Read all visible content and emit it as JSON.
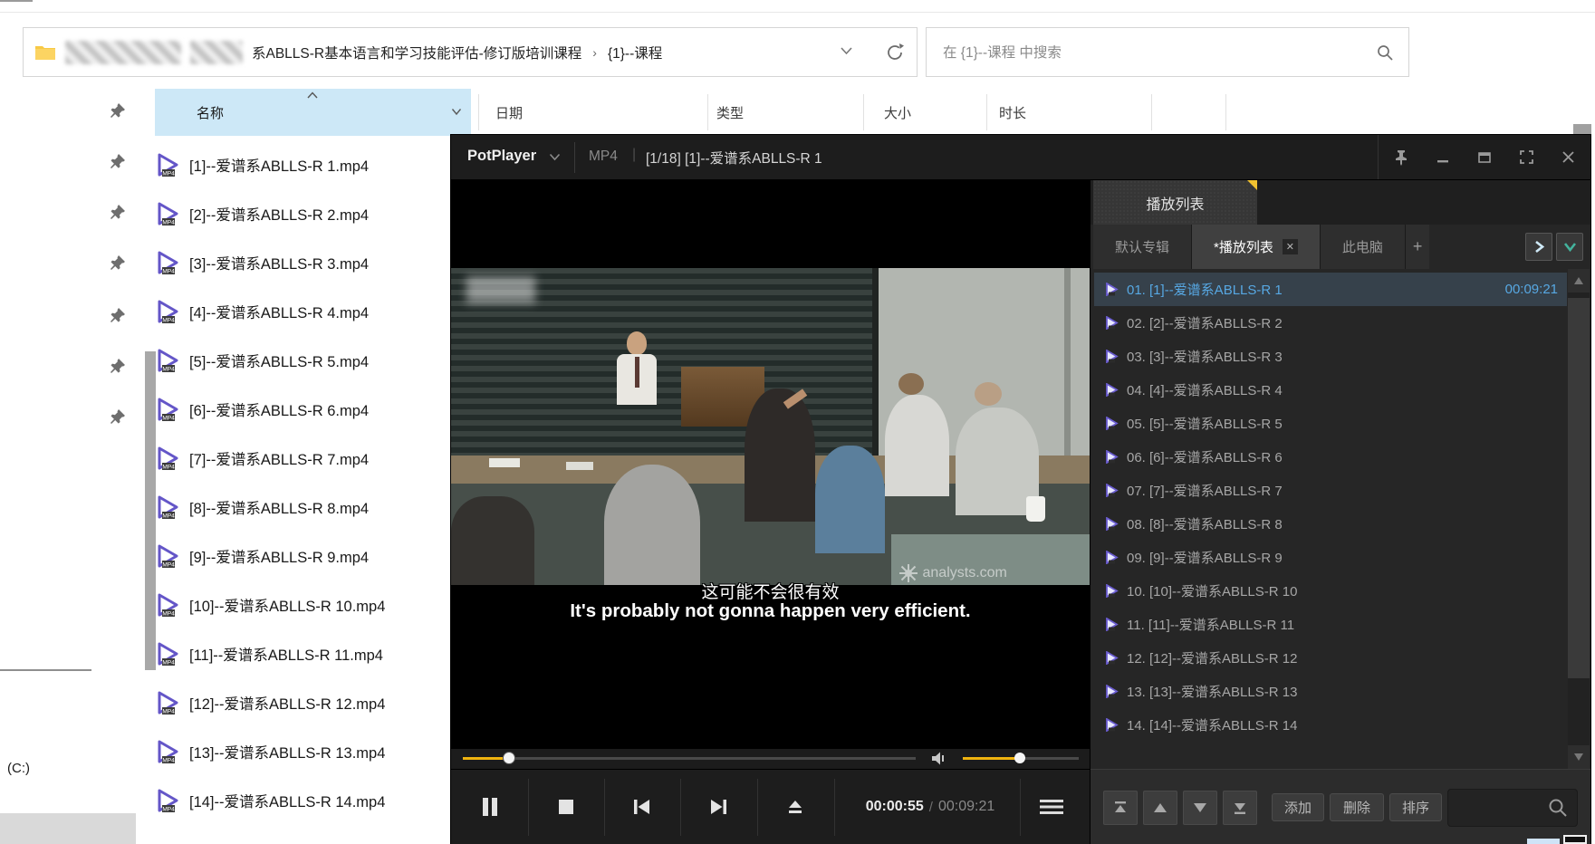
{
  "colors": {
    "accent_yellow": "#F0B40F",
    "playlist_selection_blue": "#57A8E3",
    "explorer_header_highlight": "#CDE8F7",
    "tab_corner_yellow": "#F2C230"
  },
  "explorer": {
    "address_bar": {
      "path_main": "系ABLLS-R基本语言和学习技能评估-修订版培训课程",
      "path_separator": "›",
      "path_leaf": "{1}--课程"
    },
    "search": {
      "placeholder": "在 {1}--课程 中搜索"
    },
    "columns": {
      "name": "名称",
      "date": "日期",
      "type": "类型",
      "size": "大小",
      "duration": "时长"
    },
    "files": [
      {
        "name": "[1]--爱谱系ABLLS-R 1.mp4"
      },
      {
        "name": "[2]--爱谱系ABLLS-R 2.mp4"
      },
      {
        "name": "[3]--爱谱系ABLLS-R 3.mp4"
      },
      {
        "name": "[4]--爱谱系ABLLS-R 4.mp4"
      },
      {
        "name": "[5]--爱谱系ABLLS-R 5.mp4"
      },
      {
        "name": "[6]--爱谱系ABLLS-R 6.mp4"
      },
      {
        "name": "[7]--爱谱系ABLLS-R 7.mp4"
      },
      {
        "name": "[8]--爱谱系ABLLS-R 8.mp4"
      },
      {
        "name": "[9]--爱谱系ABLLS-R 9.mp4"
      },
      {
        "name": "[10]--爱谱系ABLLS-R 10.mp4"
      },
      {
        "name": "[11]--爱谱系ABLLS-R 11.mp4"
      },
      {
        "name": "[12]--爱谱系ABLLS-R 12.mp4"
      },
      {
        "name": "[13]--爱谱系ABLLS-R 13.mp4"
      },
      {
        "name": "[14]--爱谱系ABLLS-R 14.mp4"
      }
    ],
    "drive_label": "(C:)"
  },
  "player": {
    "titlebar": {
      "app_name": "PotPlayer",
      "media_format": "MP4",
      "separator": "|",
      "title": "[1/18] [1]--爱谱系ABLLS-R 1"
    },
    "video": {
      "subtitle_zh": "这可能不会很有效",
      "subtitle_en": "It's probably not gonna happen very efficient.",
      "watermark": "analysts.com"
    },
    "transport": {
      "current_time": "00:00:55",
      "time_separator": "/",
      "total_time": "00:09:21"
    },
    "playlist": {
      "panel_title": "播放列表",
      "tabs": [
        {
          "label": "默认专辑",
          "active": false
        },
        {
          "label": "*播放列表",
          "active": true
        },
        {
          "label": "此电脑",
          "active": false
        }
      ],
      "new_tab_label": "+",
      "items": [
        {
          "label": "01. [1]--爱谱系ABLLS-R 1",
          "duration": "00:09:21",
          "active": true
        },
        {
          "label": "02. [2]--爱谱系ABLLS-R 2"
        },
        {
          "label": "03. [3]--爱谱系ABLLS-R 3"
        },
        {
          "label": "04. [4]--爱谱系ABLLS-R 4"
        },
        {
          "label": "05. [5]--爱谱系ABLLS-R 5"
        },
        {
          "label": "06. [6]--爱谱系ABLLS-R 6"
        },
        {
          "label": "07. [7]--爱谱系ABLLS-R 7"
        },
        {
          "label": "08. [8]--爱谱系ABLLS-R 8"
        },
        {
          "label": "09. [9]--爱谱系ABLLS-R 9"
        },
        {
          "label": "10. [10]--爱谱系ABLLS-R 10"
        },
        {
          "label": "11. [11]--爱谱系ABLLS-R 11"
        },
        {
          "label": "12. [12]--爱谱系ABLLS-R 12"
        },
        {
          "label": "13. [13]--爱谱系ABLLS-R 13"
        },
        {
          "label": "14. [14]--爱谱系ABLLS-R 14"
        }
      ],
      "toolbar": {
        "add": "添加",
        "remove": "删除",
        "sort": "排序"
      }
    }
  }
}
